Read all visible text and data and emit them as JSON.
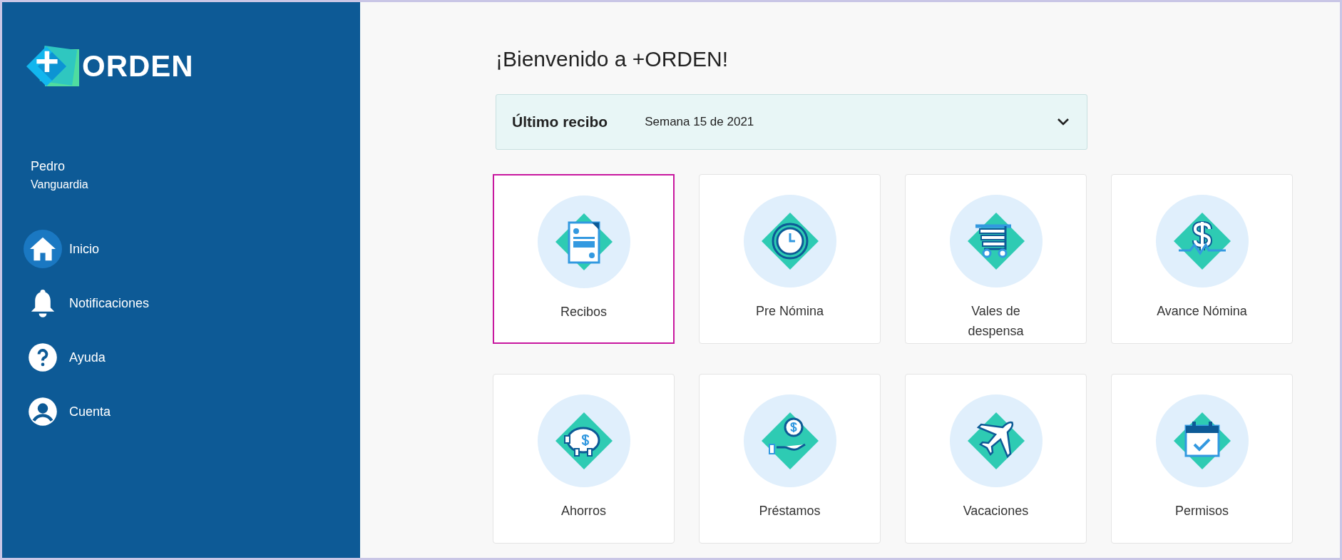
{
  "sidebar": {
    "logo": {
      "plus": "+",
      "text": "ORDEN"
    },
    "user": {
      "first_name": "Pedro",
      "last_name": "Vanguardia"
    },
    "items": [
      {
        "label": "Inicio",
        "kind": "home",
        "selected": true
      },
      {
        "label": "Notificaciones",
        "kind": "bell",
        "selected": false
      },
      {
        "label": "Ayuda",
        "kind": "help",
        "selected": false
      },
      {
        "label": "Cuenta",
        "kind": "account",
        "selected": false
      }
    ]
  },
  "main": {
    "title": "¡Bienvenido a +ORDEN!",
    "latest_receipt": {
      "label": "Último recibo",
      "value": "Semana 15 de 2021",
      "expanded": false
    },
    "cards": [
      {
        "label": "Recibos",
        "kind": "receipt",
        "selected": true
      },
      {
        "label": "Pre Nómina",
        "kind": "clock",
        "selected": false
      },
      {
        "label": "Vales de despensa",
        "kind": "cart",
        "selected": false
      },
      {
        "label": "Avance Nómina",
        "kind": "dollar",
        "selected": false
      },
      {
        "label": "Ahorros",
        "kind": "piggy",
        "selected": false
      },
      {
        "label": "Préstamos",
        "kind": "loan",
        "selected": false
      },
      {
        "label": "Vacaciones",
        "kind": "plane",
        "selected": false
      },
      {
        "label": "Permisos",
        "kind": "calendar",
        "selected": false
      }
    ]
  }
}
